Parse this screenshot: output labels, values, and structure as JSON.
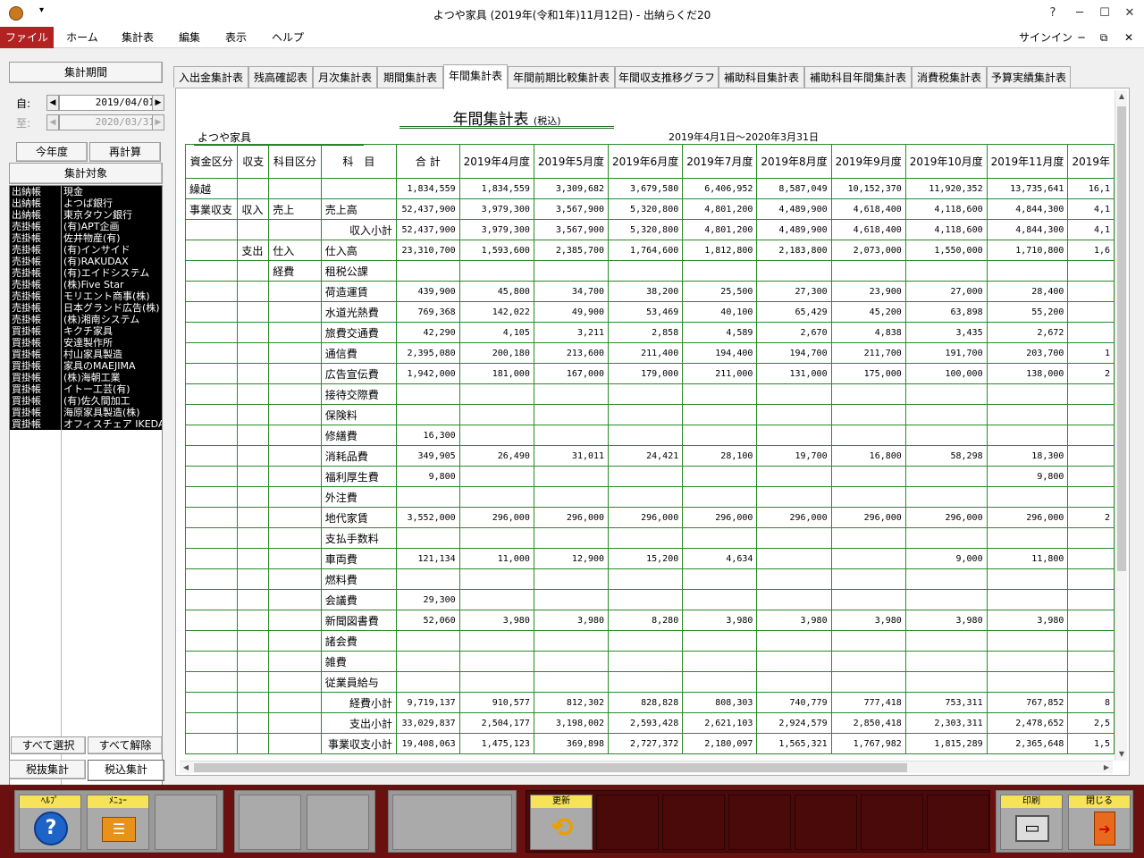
{
  "window": {
    "title": "よつや家具 (2019年(令和1年)11月12日) - 出納らくだ20",
    "help_glyph": "?",
    "minimize_glyph": "─",
    "restore_glyph": "☐",
    "close_glyph": "✕"
  },
  "ribbon": {
    "tabs": [
      "ファイル",
      "ホーム",
      "集計表",
      "編集",
      "表示",
      "ヘルプ"
    ],
    "signin": "サインイン"
  },
  "side": {
    "period_button": "集計期間",
    "from_label": "自:",
    "from_value": "2019/04/01",
    "to_label": "至:",
    "to_value": "2020/03/31",
    "this_year_button": "今年度",
    "recalc_button": "再計算",
    "target_button": "集計対象",
    "targets": [
      {
        "book": "出納帳",
        "name": "現金"
      },
      {
        "book": "出納帳",
        "name": "よつば銀行"
      },
      {
        "book": "出納帳",
        "name": "東京タウン銀行"
      },
      {
        "book": "売掛帳",
        "name": "(有)APT企画"
      },
      {
        "book": "売掛帳",
        "name": "佐井物産(有)"
      },
      {
        "book": "売掛帳",
        "name": "(有)インサイド"
      },
      {
        "book": "売掛帳",
        "name": "(有)RAKUDAX"
      },
      {
        "book": "売掛帳",
        "name": "(有)エイドシステム"
      },
      {
        "book": "売掛帳",
        "name": "(株)Five Star"
      },
      {
        "book": "売掛帳",
        "name": "モリエント商事(株)"
      },
      {
        "book": "売掛帳",
        "name": "日本グランド広告(株)"
      },
      {
        "book": "売掛帳",
        "name": "(株)湘南システム"
      },
      {
        "book": "買掛帳",
        "name": "キクチ家具"
      },
      {
        "book": "買掛帳",
        "name": "安達製作所"
      },
      {
        "book": "買掛帳",
        "name": "村山家具製造"
      },
      {
        "book": "買掛帳",
        "name": "家具のMAEJIMA"
      },
      {
        "book": "買掛帳",
        "name": "(株)海朝工業"
      },
      {
        "book": "買掛帳",
        "name": "イトー工芸(有)"
      },
      {
        "book": "買掛帳",
        "name": "(有)佐久間加工"
      },
      {
        "book": "買掛帳",
        "name": "海原家具製造(株)"
      },
      {
        "book": "買掛帳",
        "name": "オフィスチェア IKEDA"
      }
    ],
    "select_all": "すべて選択",
    "deselect_all": "すべて解除",
    "tax_excl": "税抜集計",
    "tax_incl": "税込集計"
  },
  "tabs": [
    "入出金集計表",
    "残高確認表",
    "月次集計表",
    "期間集計表",
    "年間集計表",
    "年間前期比較集計表",
    "年間収支推移グラフ",
    "補助科目集計表",
    "補助科目年間集計表",
    "消費税集計表",
    "予算実績集計表"
  ],
  "active_tab": 4,
  "report": {
    "title": "年間集計表",
    "tax_note": "(税込)",
    "company": "よつや家具",
    "period": "2019年4月1日～2020年3月31日",
    "headers": [
      "資金区分",
      "収支",
      "科目区分",
      "科　目",
      "合 計",
      "2019年4月度",
      "2019年5月度",
      "2019年6月度",
      "2019年7月度",
      "2019年8月度",
      "2019年9月度",
      "2019年10月度",
      "2019年11月度",
      "2019年"
    ],
    "rows": [
      {
        "c1": "繰越",
        "c2": "",
        "c3": "",
        "c4": "",
        "vals": [
          "1,834,559",
          "1,834,559",
          "3,309,682",
          "3,679,580",
          "6,406,952",
          "8,587,049",
          "10,152,370",
          "11,920,352",
          "13,735,641",
          "16,1"
        ]
      },
      {
        "c1": "事業収支",
        "c2": "収入",
        "c3": "売上",
        "c4": "売上高",
        "vals": [
          "52,437,900",
          "3,979,300",
          "3,567,900",
          "5,320,800",
          "4,801,200",
          "4,489,900",
          "4,618,400",
          "4,118,600",
          "4,844,300",
          "4,1"
        ]
      },
      {
        "c1": "",
        "c2": "",
        "c3": "",
        "c4": "収入小計",
        "sub": true,
        "vals": [
          "52,437,900",
          "3,979,300",
          "3,567,900",
          "5,320,800",
          "4,801,200",
          "4,489,900",
          "4,618,400",
          "4,118,600",
          "4,844,300",
          "4,1"
        ]
      },
      {
        "c1": "",
        "c2": "支出",
        "c3": "仕入",
        "c4": "仕入高",
        "vals": [
          "23,310,700",
          "1,593,600",
          "2,385,700",
          "1,764,600",
          "1,812,800",
          "2,183,800",
          "2,073,000",
          "1,550,000",
          "1,710,800",
          "1,6"
        ]
      },
      {
        "c1": "",
        "c2": "",
        "c3": "経費",
        "c4": "租税公課",
        "vals": [
          "",
          "",
          "",
          "",
          "",
          "",
          "",
          "",
          "",
          ""
        ]
      },
      {
        "c1": "",
        "c2": "",
        "c3": "",
        "c4": "荷造運賃",
        "vals": [
          "439,900",
          "45,800",
          "34,700",
          "38,200",
          "25,500",
          "27,300",
          "23,900",
          "27,000",
          "28,400",
          ""
        ]
      },
      {
        "c1": "",
        "c2": "",
        "c3": "",
        "c4": "水道光熱費",
        "vals": [
          "769,368",
          "142,022",
          "49,900",
          "53,469",
          "40,100",
          "65,429",
          "45,200",
          "63,898",
          "55,200",
          ""
        ]
      },
      {
        "c1": "",
        "c2": "",
        "c3": "",
        "c4": "旅費交通費",
        "vals": [
          "42,290",
          "4,105",
          "3,211",
          "2,858",
          "4,589",
          "2,670",
          "4,838",
          "3,435",
          "2,672",
          ""
        ]
      },
      {
        "c1": "",
        "c2": "",
        "c3": "",
        "c4": "通信費",
        "vals": [
          "2,395,080",
          "200,180",
          "213,600",
          "211,400",
          "194,400",
          "194,700",
          "211,700",
          "191,700",
          "203,700",
          "1"
        ]
      },
      {
        "c1": "",
        "c2": "",
        "c3": "",
        "c4": "広告宣伝費",
        "vals": [
          "1,942,000",
          "181,000",
          "167,000",
          "179,000",
          "211,000",
          "131,000",
          "175,000",
          "100,000",
          "138,000",
          "2"
        ]
      },
      {
        "c1": "",
        "c2": "",
        "c3": "",
        "c4": "接待交際費",
        "vals": [
          "",
          "",
          "",
          "",
          "",
          "",
          "",
          "",
          "",
          ""
        ]
      },
      {
        "c1": "",
        "c2": "",
        "c3": "",
        "c4": "保険料",
        "vals": [
          "",
          "",
          "",
          "",
          "",
          "",
          "",
          "",
          "",
          ""
        ]
      },
      {
        "c1": "",
        "c2": "",
        "c3": "",
        "c4": "修繕費",
        "vals": [
          "16,300",
          "",
          "",
          "",
          "",
          "",
          "",
          "",
          "",
          ""
        ]
      },
      {
        "c1": "",
        "c2": "",
        "c3": "",
        "c4": "消耗品費",
        "vals": [
          "349,905",
          "26,490",
          "31,011",
          "24,421",
          "28,100",
          "19,700",
          "16,800",
          "58,298",
          "18,300",
          ""
        ]
      },
      {
        "c1": "",
        "c2": "",
        "c3": "",
        "c4": "福利厚生費",
        "vals": [
          "9,800",
          "",
          "",
          "",
          "",
          "",
          "",
          "",
          "9,800",
          ""
        ]
      },
      {
        "c1": "",
        "c2": "",
        "c3": "",
        "c4": "外注費",
        "vals": [
          "",
          "",
          "",
          "",
          "",
          "",
          "",
          "",
          "",
          ""
        ]
      },
      {
        "c1": "",
        "c2": "",
        "c3": "",
        "c4": "地代家賃",
        "vals": [
          "3,552,000",
          "296,000",
          "296,000",
          "296,000",
          "296,000",
          "296,000",
          "296,000",
          "296,000",
          "296,000",
          "2"
        ]
      },
      {
        "c1": "",
        "c2": "",
        "c3": "",
        "c4": "支払手数料",
        "vals": [
          "",
          "",
          "",
          "",
          "",
          "",
          "",
          "",
          "",
          ""
        ]
      },
      {
        "c1": "",
        "c2": "",
        "c3": "",
        "c4": "車両費",
        "vals": [
          "121,134",
          "11,000",
          "12,900",
          "15,200",
          "4,634",
          "",
          "",
          "9,000",
          "11,800",
          ""
        ]
      },
      {
        "c1": "",
        "c2": "",
        "c3": "",
        "c4": "燃料費",
        "vals": [
          "",
          "",
          "",
          "",
          "",
          "",
          "",
          "",
          "",
          ""
        ]
      },
      {
        "c1": "",
        "c2": "",
        "c3": "",
        "c4": "会議費",
        "vals": [
          "29,300",
          "",
          "",
          "",
          "",
          "",
          "",
          "",
          "",
          ""
        ]
      },
      {
        "c1": "",
        "c2": "",
        "c3": "",
        "c4": "新聞図書費",
        "vals": [
          "52,060",
          "3,980",
          "3,980",
          "8,280",
          "3,980",
          "3,980",
          "3,980",
          "3,980",
          "3,980",
          ""
        ]
      },
      {
        "c1": "",
        "c2": "",
        "c3": "",
        "c4": "諸会費",
        "vals": [
          "",
          "",
          "",
          "",
          "",
          "",
          "",
          "",
          "",
          ""
        ]
      },
      {
        "c1": "",
        "c2": "",
        "c3": "",
        "c4": "雑費",
        "vals": [
          "",
          "",
          "",
          "",
          "",
          "",
          "",
          "",
          "",
          ""
        ]
      },
      {
        "c1": "",
        "c2": "",
        "c3": "",
        "c4": "従業員給与",
        "vals": [
          "",
          "",
          "",
          "",
          "",
          "",
          "",
          "",
          "",
          ""
        ]
      },
      {
        "c1": "",
        "c2": "",
        "c3": "",
        "c4": "経費小計",
        "sub": true,
        "vals": [
          "9,719,137",
          "910,577",
          "812,302",
          "828,828",
          "808,303",
          "740,779",
          "777,418",
          "753,311",
          "767,852",
          "8"
        ]
      },
      {
        "c1": "",
        "c2": "",
        "c3": "",
        "c4": "支出小計",
        "sub": true,
        "vals": [
          "33,029,837",
          "2,504,177",
          "3,198,002",
          "2,593,428",
          "2,621,103",
          "2,924,579",
          "2,850,418",
          "2,303,311",
          "2,478,652",
          "2,5"
        ]
      },
      {
        "c1": "",
        "c2": "",
        "c3": "",
        "c4": "事業収支小計",
        "sub": true,
        "vals": [
          "19,408,063",
          "1,475,123",
          "369,898",
          "2,727,372",
          "2,180,097",
          "1,565,321",
          "1,767,982",
          "1,815,289",
          "2,365,648",
          "1,5"
        ]
      }
    ]
  },
  "fkeys": {
    "help": "ﾍﾙﾌﾟ",
    "menu": "ﾒﾆｭｰ",
    "refresh": "更新",
    "print": "印刷",
    "close": "閉じる"
  }
}
